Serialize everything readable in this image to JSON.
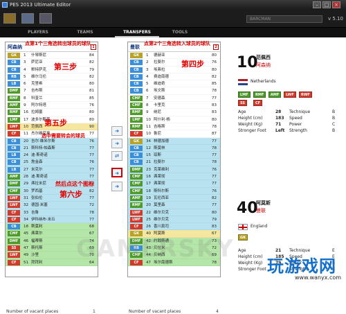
{
  "window": {
    "title": "PES 2013 Ultimate Editor"
  },
  "toolbar": {
    "search_value": "BARCMAN",
    "version": "v 5.10"
  },
  "tabs": [
    {
      "label": "PLAYERS"
    },
    {
      "label": "TEAMS"
    },
    {
      "label": "TRANSFERS"
    },
    {
      "label": "TOOLS"
    }
  ],
  "colors": {
    "GK": "#b8a22a",
    "CB": "#3a8fd8",
    "RB": "#3a8fd8",
    "LB": "#3a8fd8",
    "DMF": "#4e9a2a",
    "CMF": "#4e9a2a",
    "AMF": "#4e9a2a",
    "RMF": "#4e9a2a",
    "LMF": "#4e9a2a",
    "LWF": "#d23b2c",
    "RWF": "#d23b2c",
    "SS": "#d23b2c",
    "CF": "#d23b2c",
    "highlight_blue": "#b8e2f0",
    "highlight_green": "#b4e6a8",
    "highlight_yellow": "#f5e6a0"
  },
  "left": {
    "team": "阿森纳",
    "num": "1",
    "players": [
      {
        "pos": "GK",
        "num": "1",
        "name": "什琴斯尼",
        "rating": "84"
      },
      {
        "pos": "CB",
        "num": "3",
        "name": "萨尼亚",
        "rating": "82"
      },
      {
        "pos": "CB",
        "num": "4",
        "name": "默特萨克",
        "rating": "79"
      },
      {
        "pos": "RB",
        "num": "5",
        "name": "维尔马伦",
        "rating": "82"
      },
      {
        "pos": "LB",
        "num": "6",
        "name": "克里希",
        "rating": "80"
      },
      {
        "pos": "DMF",
        "num": "7",
        "name": "吉布斯",
        "rating": "81"
      },
      {
        "pos": "RMF",
        "num": "8",
        "name": "科奎兰",
        "rating": "85"
      },
      {
        "pos": "AMF",
        "num": "9",
        "name": "阿尔特塔",
        "rating": "76"
      },
      {
        "pos": "RMF",
        "num": "16",
        "name": "拉姆塞",
        "rating": "80"
      },
      {
        "pos": "LMF",
        "num": "17",
        "name": "波多尔斯基",
        "rating": "80"
      },
      {
        "pos": "LWF",
        "num": "10",
        "name": "范佩西",
        "rating": "90"
      },
      {
        "pos": "CF",
        "num": "11",
        "name": "杰尔维尼奥",
        "rating": "77"
      },
      {
        "pos": "CB",
        "num": "20",
        "name": "吉尔·维米尔斯",
        "rating": "76"
      },
      {
        "pos": "CB",
        "num": "21",
        "name": "斯科特·帕森斯",
        "rating": "77"
      },
      {
        "pos": "LB",
        "num": "24",
        "name": "迪·斯奇诺",
        "rating": "77"
      },
      {
        "pos": "CB",
        "num": "25",
        "name": "詹金森",
        "rating": "76"
      },
      {
        "pos": "LB",
        "num": "27",
        "name": "米克尔",
        "rating": "77"
      },
      {
        "pos": "AMF",
        "num": "28",
        "name": "迪·斯奇诺",
        "rating": "77"
      },
      {
        "pos": "DMF",
        "num": "29",
        "name": "弗拉米尼",
        "rating": "73"
      },
      {
        "pos": "CMF",
        "num": "30",
        "name": "罗西基",
        "rating": "82"
      },
      {
        "pos": "LWF",
        "num": "31",
        "name": "张伯伦",
        "rating": "77"
      },
      {
        "pos": "LWF",
        "num": "32",
        "name": "德国·米塞",
        "rating": "72"
      },
      {
        "pos": "CF",
        "num": "33",
        "name": "吉鲁",
        "rating": "78"
      },
      {
        "pos": "CF",
        "num": "34",
        "name": "伊科纳布·米丘",
        "rating": "77"
      },
      {
        "pos": "CB",
        "num": "18",
        "name": "斯莫利",
        "rating": "68"
      },
      {
        "pos": "CMF",
        "num": "45",
        "name": "弗莱尔",
        "rating": "67"
      },
      {
        "pos": "DMF",
        "num": "46",
        "name": "福蒂斯",
        "rating": "74"
      },
      {
        "pos": "SS",
        "num": "47",
        "name": "斯托斯",
        "rating": "69"
      },
      {
        "pos": "LWF",
        "num": "49",
        "name": "沙里",
        "rating": "70"
      },
      {
        "pos": "CF",
        "num": "51",
        "name": "拜拜利",
        "rating": "64"
      }
    ],
    "vacant_label": "Number of vacant places",
    "vacant": "1"
  },
  "right": {
    "team": "曼联",
    "num": "2",
    "players": [
      {
        "pos": "GK",
        "num": "1",
        "name": "德赫亚",
        "rating": "80"
      },
      {
        "pos": "CB",
        "num": "2",
        "name": "拉斐尔",
        "rating": "76"
      },
      {
        "pos": "CB",
        "num": "3",
        "name": "埃弗拉",
        "rating": "80"
      },
      {
        "pos": "CB",
        "num": "4",
        "name": "费迪南德",
        "rating": "82"
      },
      {
        "pos": "CB",
        "num": "5",
        "name": "维迪奇",
        "rating": "85"
      },
      {
        "pos": "CB",
        "num": "6",
        "name": "埃文斯",
        "rating": "78"
      },
      {
        "pos": "CMF",
        "num": "7",
        "name": "安德森",
        "rating": "77"
      },
      {
        "pos": "CMF",
        "num": "8",
        "name": "卡里克",
        "rating": "83"
      },
      {
        "pos": "RMF",
        "num": "9",
        "name": "纳尼",
        "rating": "83"
      },
      {
        "pos": "LMF",
        "num": "10",
        "name": "阿什利·杨",
        "rating": "80"
      },
      {
        "pos": "RMF",
        "num": "11",
        "name": "吉格斯",
        "rating": "78"
      },
      {
        "pos": "CF",
        "num": "10",
        "name": "鲁尼",
        "rating": "87"
      },
      {
        "pos": "GK",
        "num": "34",
        "name": "林德加德",
        "rating": "77"
      },
      {
        "pos": "CB",
        "num": "12",
        "name": "斯莫林",
        "rating": "78"
      },
      {
        "pos": "CB",
        "num": "15",
        "name": "琼斯",
        "rating": "77"
      },
      {
        "pos": "CB",
        "num": "21",
        "name": "拉斐尔",
        "rating": "78"
      },
      {
        "pos": "DMF",
        "num": "23",
        "name": "克莱维利",
        "rating": "76"
      },
      {
        "pos": "CMF",
        "num": "16",
        "name": "弗莱彻",
        "rating": "77"
      },
      {
        "pos": "CMF",
        "num": "17",
        "name": "弗莱彻",
        "rating": "77"
      },
      {
        "pos": "CMF",
        "num": "18",
        "name": "斯科尔斯",
        "rating": "76"
      },
      {
        "pos": "AMF",
        "num": "19",
        "name": "瓦伦西亚",
        "rating": "82"
      },
      {
        "pos": "RMF",
        "num": "20",
        "name": "莫里森",
        "rating": "77"
      },
      {
        "pos": "LWF",
        "num": "22",
        "name": "维尔贝克",
        "rating": "80"
      },
      {
        "pos": "LWF",
        "num": "25",
        "name": "维尔贝克",
        "rating": "79"
      },
      {
        "pos": "CF",
        "num": "26",
        "name": "香川真司",
        "rating": "83"
      },
      {
        "pos": "GK",
        "num": "40",
        "name": "阿莫斯",
        "rating": "67"
      },
      {
        "pos": "DMF",
        "num": "42",
        "name": "约翰斯通",
        "rating": "73"
      },
      {
        "pos": "RB",
        "num": "43",
        "name": "贝拉米",
        "rating": "72"
      },
      {
        "pos": "CMF",
        "num": "44",
        "name": "贝纳西",
        "rating": "69"
      },
      {
        "pos": "CF",
        "num": "47",
        "name": "埃尔南德斯",
        "rating": "78"
      }
    ],
    "vacant_label": "Number of vacant places",
    "vacant": "4"
  },
  "card1": {
    "number": "10",
    "name": "范佩西",
    "team": "阿森纳",
    "country": "Netherlands",
    "positions": [
      "LMF",
      "RMF",
      "AMF",
      "LWF",
      "RWF",
      "SS",
      "CF"
    ],
    "stats": [
      {
        "k": "Age",
        "v": "28"
      },
      {
        "k": "Height (cm)",
        "v": "183"
      },
      {
        "k": "Weight (Kg)",
        "v": "71"
      },
      {
        "k": "Stronger Foot",
        "v": "Left"
      }
    ],
    "skills": [
      {
        "k": "Technique",
        "v": "B"
      },
      {
        "k": "Speed",
        "v": "B"
      },
      {
        "k": "Power",
        "v": "C"
      },
      {
        "k": "Strength",
        "v": "B"
      }
    ]
  },
  "card2": {
    "number": "40",
    "name": "阿莫斯",
    "team": "曼联",
    "country": "England",
    "positions": [
      "GK"
    ],
    "stats": [
      {
        "k": "Age",
        "v": "21"
      },
      {
        "k": "Height (cm)",
        "v": "185"
      },
      {
        "k": "Weight (Kg)",
        "v": "79"
      },
      {
        "k": "Stronger Foot",
        "v": ""
      }
    ],
    "skills": [
      {
        "k": "Technique",
        "v": "E"
      },
      {
        "k": "Speed",
        "v": "E"
      },
      {
        "k": "Power",
        "v": "B"
      },
      {
        "k": "Strength",
        "v": "B"
      }
    ]
  },
  "annotations": {
    "a1": "点第1个三角选转出球员的球队",
    "a2": "点第2个三角选转入球员的球队",
    "step3": "第三步",
    "step4": "第四步",
    "step5": "第五步",
    "a5": "选中需要转会的球员",
    "a6": "然后点这个图标",
    "step6": "第六步"
  },
  "watermark": "GAMERSKY",
  "logo": {
    "text": "玩游戏网",
    "url": "www.wanyx.com"
  }
}
